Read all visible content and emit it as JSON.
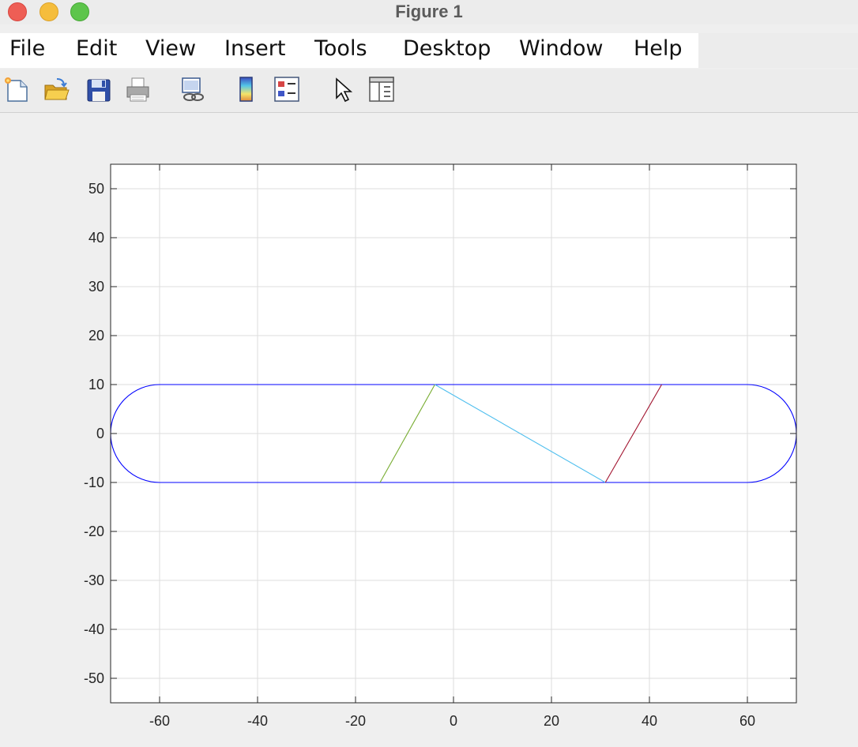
{
  "window": {
    "title": "Figure 1",
    "traffic_lights": [
      "close",
      "minimize",
      "maximize"
    ]
  },
  "menu": {
    "items": [
      "File",
      "Edit",
      "View",
      "Insert",
      "Tools",
      "Desktop",
      "Window",
      "Help"
    ]
  },
  "toolbar": {
    "tools": [
      "new-figure-icon",
      "open-file-icon",
      "save-icon",
      "print-icon",
      "link-plot-icon",
      "colorbar-icon",
      "legend-icon",
      "pointer-icon",
      "property-inspector-icon"
    ]
  },
  "colors": {
    "track": "#0000ff",
    "green_segment": "#77ac30",
    "cyan_segment": "#4dbeee",
    "maroon_segment": "#a2142f",
    "grid": "#dedede"
  },
  "chart_data": {
    "type": "line",
    "xlim": [
      -70,
      70
    ],
    "ylim": [
      -55,
      55
    ],
    "xticks": [
      -60,
      -40,
      -20,
      0,
      20,
      40,
      60
    ],
    "yticks": [
      50,
      40,
      30,
      20,
      10,
      0,
      -10,
      -20,
      -30,
      -40,
      -50
    ],
    "grid": true,
    "series": [
      {
        "color": "#0000ff",
        "shape": "stadium",
        "top": [
          [
            -60,
            10
          ],
          [
            60,
            10
          ]
        ],
        "bottom": [
          [
            60,
            -10
          ],
          [
            -60,
            -10
          ]
        ],
        "right_arc": {
          "center": [
            60,
            0
          ],
          "radius": 10
        },
        "left_arc": {
          "center": [
            -60,
            0
          ],
          "radius": 10
        }
      },
      {
        "color": "#77ac30",
        "x": [
          -15,
          -3.8
        ],
        "y": [
          -10,
          10
        ]
      },
      {
        "color": "#4dbeee",
        "x": [
          -3.8,
          31
        ],
        "y": [
          10,
          -10
        ]
      },
      {
        "color": "#a2142f",
        "x": [
          31,
          42.5
        ],
        "y": [
          -10,
          10
        ]
      }
    ]
  }
}
